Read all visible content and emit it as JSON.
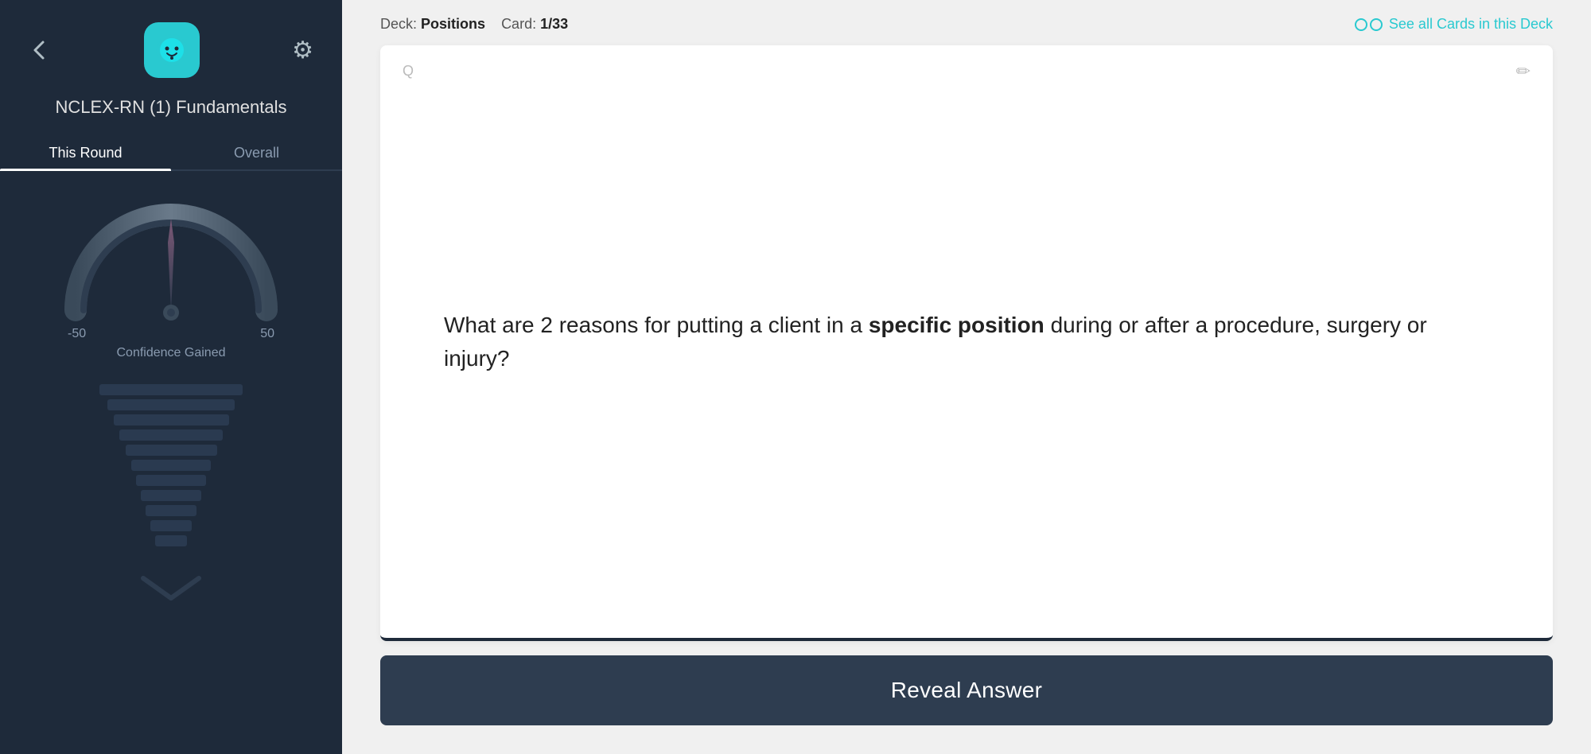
{
  "sidebar": {
    "deck_title": "NCLEX-RN (1) Fundamentals",
    "tabs": [
      {
        "id": "this-round",
        "label": "This Round",
        "active": true
      },
      {
        "id": "overall",
        "label": "Overall",
        "active": false
      }
    ],
    "gauge": {
      "min_label": "-50",
      "max_label": "50",
      "confidence_label": "Confidence Gained"
    }
  },
  "header": {
    "deck_prefix": "Deck:",
    "deck_name": "Positions",
    "card_prefix": "Card:",
    "card_number": "1/33",
    "see_cards_label": "See all Cards in this Deck"
  },
  "card": {
    "type_label": "Q",
    "question_part1": "What are 2 reasons for putting a client in a ",
    "question_bold": "specific position",
    "question_part2": " during or after a procedure, surgery or injury?"
  },
  "reveal_button": {
    "label": "Reveal Answer"
  },
  "icons": {
    "back": "‹",
    "gear": "⚙",
    "edit": "✏"
  }
}
